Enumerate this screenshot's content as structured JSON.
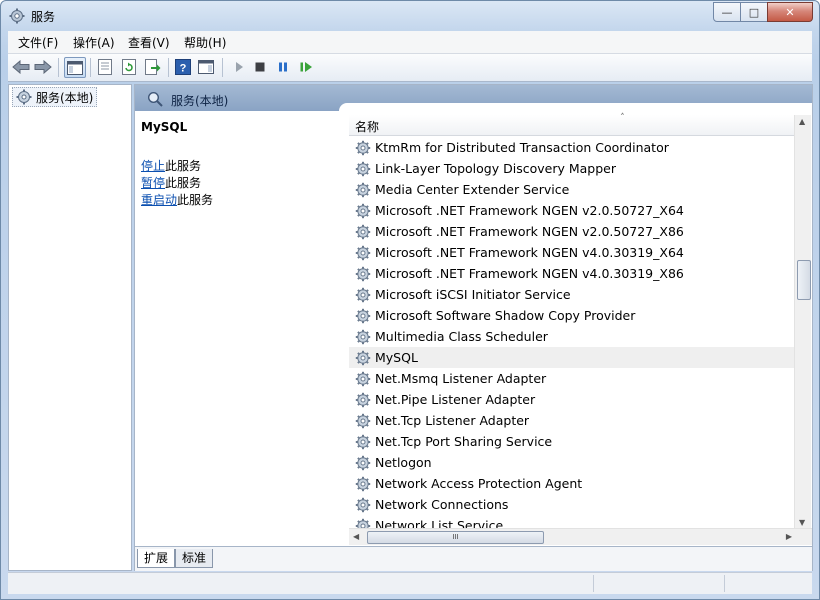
{
  "window": {
    "title": "服务",
    "controls": {
      "minimize": "—",
      "maximize": "□",
      "close": "✕"
    }
  },
  "menu": [
    {
      "label": "文件(F)"
    },
    {
      "label": "操作(A)"
    },
    {
      "label": "查看(V)"
    },
    {
      "label": "帮助(H)"
    }
  ],
  "tree": {
    "item": "服务(本地)"
  },
  "content_header": {
    "title": "服务(本地)"
  },
  "detail": {
    "service_name": "MySQL",
    "actions": [
      {
        "link": "停止",
        "suffix": "此服务"
      },
      {
        "link": "暂停",
        "suffix": "此服务"
      },
      {
        "link": "重启动",
        "suffix": "此服务"
      }
    ]
  },
  "list": {
    "column_header": "名称",
    "sort_caret": "˄",
    "selected_index": 10,
    "rows": [
      "KtmRm for Distributed Transaction Coordinator",
      "Link-Layer Topology Discovery Mapper",
      "Media Center Extender Service",
      "Microsoft .NET Framework NGEN v2.0.50727_X64",
      "Microsoft .NET Framework NGEN v2.0.50727_X86",
      "Microsoft .NET Framework NGEN v4.0.30319_X64",
      "Microsoft .NET Framework NGEN v4.0.30319_X86",
      "Microsoft iSCSI Initiator Service",
      "Microsoft Software Shadow Copy Provider",
      "Multimedia Class Scheduler",
      "MySQL",
      "Net.Msmq Listener Adapter",
      "Net.Pipe Listener Adapter",
      "Net.Tcp Listener Adapter",
      "Net.Tcp Port Sharing Service",
      "Netlogon",
      "Network Access Protection Agent",
      "Network Connections",
      "Network List Service"
    ],
    "hscroll_grip": "III"
  },
  "tabs": [
    {
      "label": "扩展",
      "active": true
    },
    {
      "label": "标准",
      "active": false
    }
  ],
  "colors": {
    "link": "#0b4fb0",
    "header_bar": "#8aa3c4",
    "selected_row": "#efefef",
    "play_green": "#3aa33a",
    "pause_blue": "#2a6fc9"
  }
}
